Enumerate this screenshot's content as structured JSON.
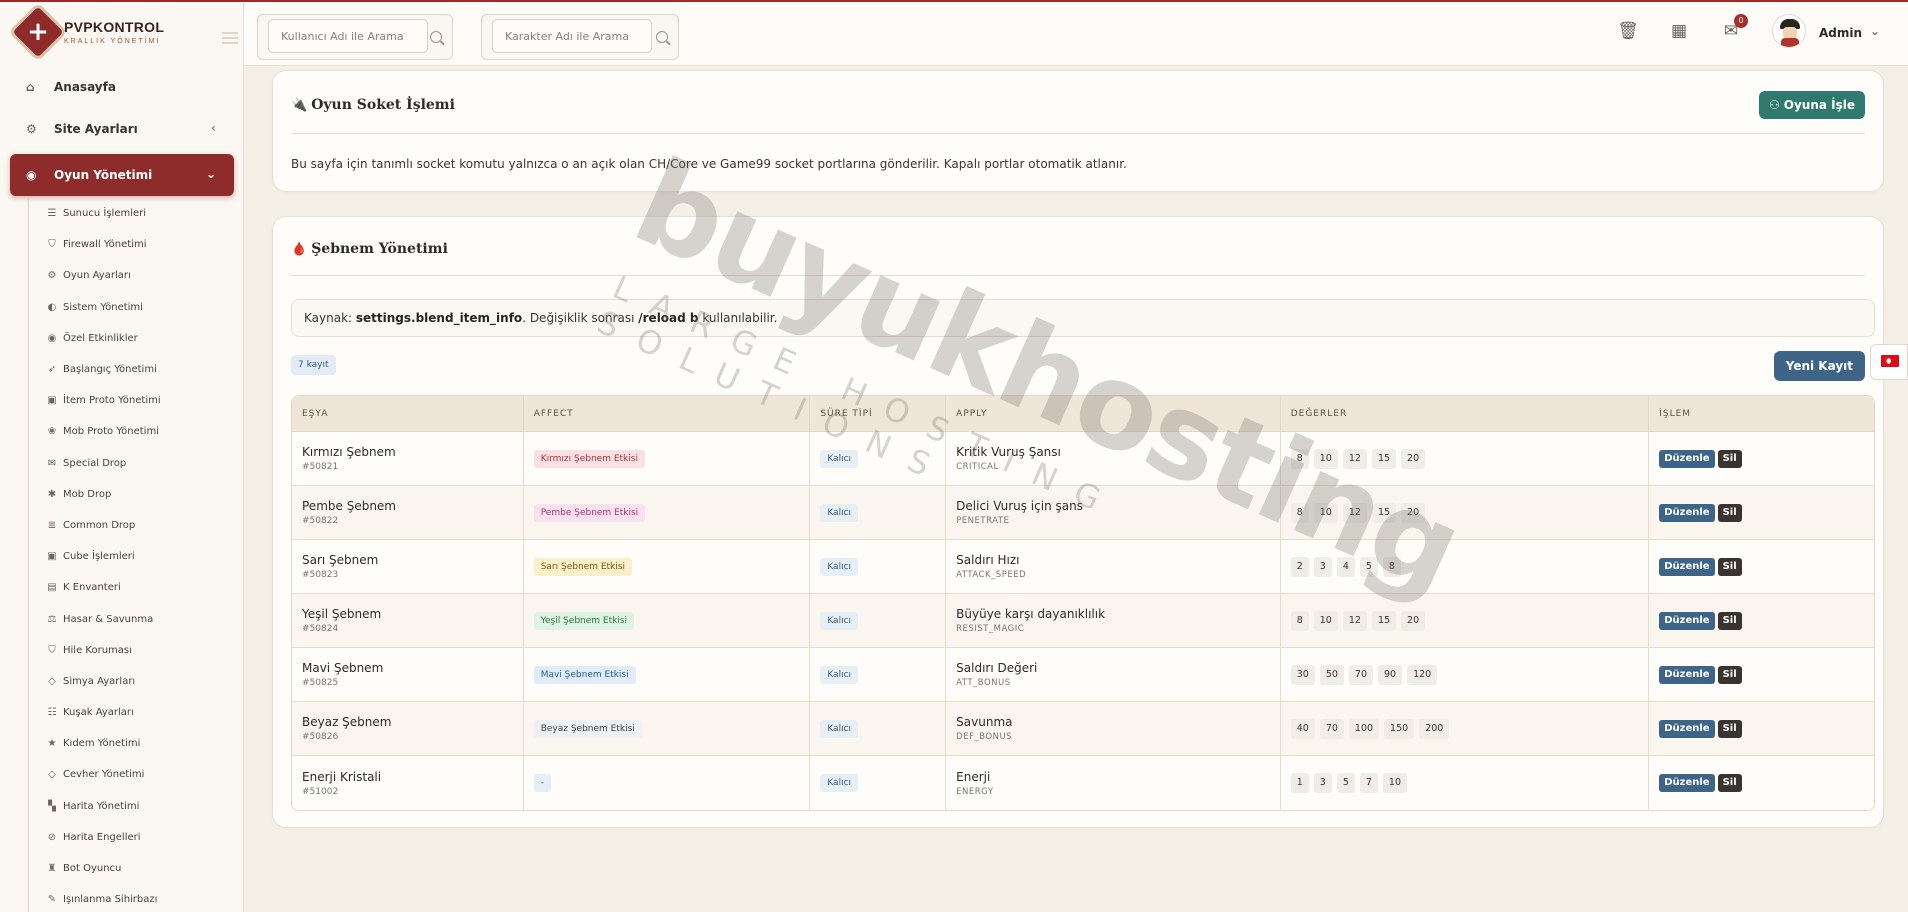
{
  "brand": {
    "title": "PVPKONTROL",
    "subtitle": "KRALLIK YÖNETİMİ"
  },
  "sidebar": {
    "top_items": [
      {
        "label": "Anasayfa",
        "icon": "home-icon"
      },
      {
        "label": "Site Ayarları",
        "icon": "gear-icon"
      },
      {
        "label": "Oyun Yönetimi",
        "icon": "gamepad-icon"
      }
    ],
    "sub_items": [
      {
        "label": "Sunucu İşlemleri",
        "icon": "server-icon"
      },
      {
        "label": "Firewall Yönetimi",
        "icon": "shield-icon"
      },
      {
        "label": "Oyun Ayarları",
        "icon": "cogs-icon"
      },
      {
        "label": "Sistem Yönetimi",
        "icon": "toggle-icon"
      },
      {
        "label": "Özel Etkinlikler",
        "icon": "gamepad-icon"
      },
      {
        "label": "Başlangıç Yönetimi",
        "icon": "rocket-icon"
      },
      {
        "label": "İtem Proto Yönetimi",
        "icon": "cube-icon"
      },
      {
        "label": "Mob Proto Yönetimi",
        "icon": "paw-icon"
      },
      {
        "label": "Special Drop",
        "icon": "gift-icon"
      },
      {
        "label": "Mob Drop",
        "icon": "bug-icon"
      },
      {
        "label": "Common Drop",
        "icon": "list-icon"
      },
      {
        "label": "Cube İşlemleri",
        "icon": "cube-icon"
      },
      {
        "label": "K Envanteri",
        "icon": "inventory-icon"
      },
      {
        "label": "Hasar & Savunma",
        "icon": "scale-icon"
      },
      {
        "label": "Hile Koruması",
        "icon": "shield-icon"
      },
      {
        "label": "Simya Ayarları",
        "icon": "gem-icon"
      },
      {
        "label": "Kuşak Ayarları",
        "icon": "sliders-icon"
      },
      {
        "label": "Kıdem Yönetimi",
        "icon": "star-icon"
      },
      {
        "label": "Cevher Yönetimi",
        "icon": "gem-icon"
      },
      {
        "label": "Harita Yönetimi",
        "icon": "map-icon"
      },
      {
        "label": "Harita Engelleri",
        "icon": "ban-icon"
      },
      {
        "label": "Bot Oyuncu",
        "icon": "robot-icon"
      },
      {
        "label": "Işınlanma Sihirbazı",
        "icon": "wand-icon"
      }
    ]
  },
  "header": {
    "search_user_placeholder": "Kullanıcı Adı ile Arama",
    "search_char_placeholder": "Karakter Adı ile Arama",
    "notification_count": "0",
    "admin_name": "Admin"
  },
  "socket_card": {
    "title": "Oyun Soket İşlemi",
    "button": "Oyuna İşle",
    "text": "Bu sayfa için tanımlı socket komutu yalnızca o an açık olan CH/Core ve Game99 socket portlarına gönderilir. Kapalı portlar otomatik atlanır."
  },
  "blend_card": {
    "title": "Şebnem Yönetimi",
    "info_prefix": "Kaynak: ",
    "info_source": "settings.blend_item_info",
    "info_middle": ". Değişiklik sonrası ",
    "info_command": "/reload b",
    "info_suffix": " kullanılabilir.",
    "count_badge": "7 kayıt",
    "new_button": "Yeni Kayıt",
    "columns": [
      "EŞYA",
      "AFFECT",
      "SÜRE TİPİ",
      "APPLY",
      "DEĞERLER",
      "İŞLEM"
    ],
    "edit_label": "Düzenle",
    "delete_label": "Sil",
    "rows": [
      {
        "name": "Kırmızı Şebnem",
        "id": "#50821",
        "affect": "Kırmızı Şebnem Etkisi",
        "affect_bg": "#f9e1e3",
        "affect_fg": "#b0303a",
        "duration": "Kalıcı",
        "apply_name": "Kritik Vuruş Şansı",
        "apply_code": "CRITICAL",
        "values": [
          "8",
          "10",
          "12",
          "15",
          "20"
        ]
      },
      {
        "name": "Pembe Şebnem",
        "id": "#50822",
        "affect": "Pembe Şebnem Etkisi",
        "affect_bg": "#f9e2ef",
        "affect_fg": "#b0306e",
        "duration": "Kalıcı",
        "apply_name": "Delici Vuruş için şans",
        "apply_code": "PENETRATE",
        "values": [
          "8",
          "10",
          "12",
          "15",
          "20"
        ]
      },
      {
        "name": "Sarı Şebnem",
        "id": "#50823",
        "affect": "Sarı Şebnem Etkisi",
        "affect_bg": "#fbf0c9",
        "affect_fg": "#7a5a0a",
        "duration": "Kalıcı",
        "apply_name": "Saldırı Hızı",
        "apply_code": "ATTACK_SPEED",
        "values": [
          "2",
          "3",
          "4",
          "5",
          "8"
        ]
      },
      {
        "name": "Yeşil Şebnem",
        "id": "#50824",
        "affect": "Yeşil Şebnem Etkisi",
        "affect_bg": "#dff2e3",
        "affect_fg": "#2a7a3c",
        "duration": "Kalıcı",
        "apply_name": "Büyüye karşı dayanıklılık",
        "apply_code": "RESIST_MAGIC",
        "values": [
          "8",
          "10",
          "12",
          "15",
          "20"
        ]
      },
      {
        "name": "Mavi Şebnem",
        "id": "#50825",
        "affect": "Mavi Şebnem Etkisi",
        "affect_bg": "#e0ecf8",
        "affect_fg": "#2d5d8a",
        "duration": "Kalıcı",
        "apply_name": "Saldırı Değeri",
        "apply_code": "ATT_BONUS",
        "values": [
          "30",
          "50",
          "70",
          "90",
          "120"
        ]
      },
      {
        "name": "Beyaz Şebnem",
        "id": "#50826",
        "affect": "Beyaz Şebnem Etkisi",
        "affect_bg": "#eef0f2",
        "affect_fg": "#3c4550",
        "duration": "Kalıcı",
        "apply_name": "Savunma",
        "apply_code": "DEF_BONUS",
        "values": [
          "40",
          "70",
          "100",
          "150",
          "200"
        ]
      },
      {
        "name": "Enerji Kristali",
        "id": "#51002",
        "affect": "-",
        "affect_bg": "#e6eef6",
        "affect_fg": "#3d5a77",
        "duration": "Kalıcı",
        "apply_name": "Enerji",
        "apply_code": "ENERGY",
        "values": [
          "1",
          "3",
          "5",
          "7",
          "10"
        ]
      }
    ]
  },
  "watermark": {
    "main": "buyukhosting",
    "sub": "LARGE HOSTING SOLUTIONS"
  },
  "colors": {
    "brand_red": "#8e2c2c",
    "teal_button": "#2f7a6e",
    "blue_button": "#3e6487",
    "background": "#f4efe7"
  }
}
